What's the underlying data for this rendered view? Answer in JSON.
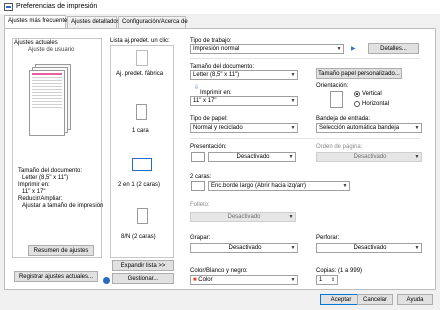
{
  "window": {
    "title": "Preferencias de impresión"
  },
  "tabs": [
    "Ajustes más frecuentes",
    "Ajustes detallados",
    "Configuración/Acerca de"
  ],
  "current_settings": {
    "header": "Ajustes actuales",
    "subheader": "Ajuste de usuario",
    "summary_lines": [
      "Tamaño del documento:",
      "Letter (8,5\" x 11\")",
      "Imprimir en:",
      "11\" x 17\"",
      "Reducir/Ampliar:",
      "Ajustar a tamaño de impresión"
    ],
    "summary_button": "Resumen de ajustes"
  },
  "presets": {
    "header": "Lista aj.predet. un clic:",
    "items": [
      "Aj. predet. fábrica",
      "1 cara",
      "2 en 1 (2 caras)",
      "8/N (2 caras)"
    ],
    "expand_button": "Expandir lista >>",
    "manage_button": "Gestionar...",
    "register_button": "Registrar ajustes actuales..."
  },
  "job_type": {
    "label": "Tipo de trabajo:",
    "value": "Impresión normal",
    "details_button": "Detalles..."
  },
  "document_size": {
    "label": "Tamaño del documento:",
    "value": "Letter (8,5\" x 11\")",
    "custom_button": "Tamaño papel personalizado..."
  },
  "print_on": {
    "label": "Imprimir en:",
    "value": "11\" x 17\""
  },
  "orientation": {
    "label": "Orientación:",
    "options": [
      "Vertical",
      "Horizontal"
    ],
    "selected": "Vertical"
  },
  "paper_type": {
    "label": "Tipo de papel:",
    "value": "Normal y reciclado"
  },
  "input_tray": {
    "label": "Bandeja de entrada:",
    "value": "Selección automática bandeja"
  },
  "layout": {
    "label": "Presentación:",
    "value": "Desactivado"
  },
  "page_order": {
    "label": "Orden de página:",
    "value": "Desactivado"
  },
  "duplex": {
    "label": "2 caras:",
    "value": "Enc.borde largo (Abrir hacia izq/arr)"
  },
  "booklet": {
    "label": "Folleto:",
    "value": "Desactivado"
  },
  "staple": {
    "label": "Grapar:",
    "value": "Desactivado"
  },
  "punch": {
    "label": "Perforar:",
    "value": "Desactivado"
  },
  "color": {
    "label": "Color/Blanco y negro:",
    "value": "Color"
  },
  "copies": {
    "label": "Copias: (1 a 999)",
    "value": "1"
  },
  "footer": {
    "accept": "Aceptar",
    "cancel": "Cancelar",
    "help": "Ayuda"
  },
  "icons": {
    "window": "printer-icon",
    "dropdown": "chevron-down-icon",
    "arrow": "triangle-right-icon"
  },
  "colors": {
    "accent": "#0078d7",
    "panel": "#ffffff",
    "background": "#f0f0f0"
  }
}
